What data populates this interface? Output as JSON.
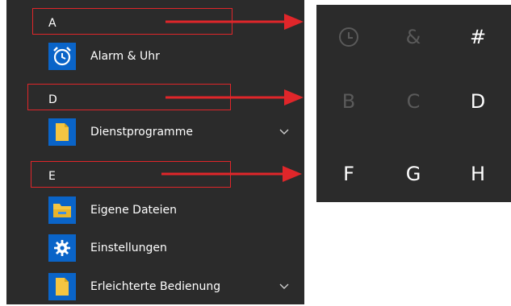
{
  "start_list": {
    "groups": [
      {
        "letter": "A",
        "apps": [
          {
            "label": "Alarm & Uhr",
            "icon": "alarm-clock-icon"
          }
        ]
      },
      {
        "letter": "D",
        "apps": [
          {
            "label": "Dienstprogramme",
            "icon": "folder-icon"
          }
        ]
      },
      {
        "letter": "E",
        "apps": [
          {
            "label": "Eigene Dateien",
            "icon": "file-explorer-icon"
          },
          {
            "label": "Einstellungen",
            "icon": "gear-icon"
          },
          {
            "label": "Erleichterte Bedienung",
            "icon": "folder-icon"
          }
        ]
      }
    ]
  },
  "jump_grid": {
    "cells": [
      {
        "label": "",
        "icon": "clock-icon",
        "enabled": false
      },
      {
        "label": "&",
        "enabled": false
      },
      {
        "label": "#",
        "enabled": true
      },
      {
        "label": "B",
        "enabled": false
      },
      {
        "label": "C",
        "enabled": false
      },
      {
        "label": "D",
        "enabled": true
      },
      {
        "label": "F",
        "enabled": true
      },
      {
        "label": "G",
        "enabled": true
      },
      {
        "label": "H",
        "enabled": true
      }
    ]
  },
  "colors": {
    "panel_bg": "#2b2b2b",
    "tile_blue": "#0a64c8",
    "annotation_red": "#e0262a",
    "disabled_text": "#5a5a5a"
  }
}
